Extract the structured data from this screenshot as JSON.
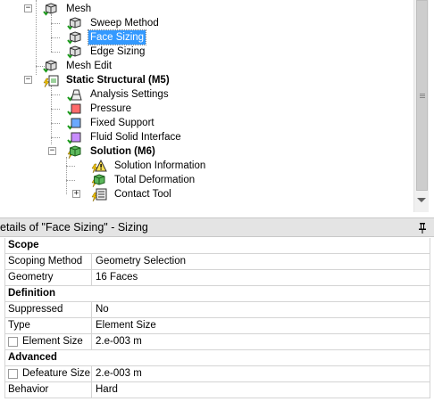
{
  "tree": {
    "nodes": [
      {
        "label": "Mesh",
        "icon": "mesh-icon",
        "bold": false,
        "selected": false
      },
      {
        "label": "Sweep Method",
        "icon": "sweep-method-icon",
        "bold": false,
        "selected": false
      },
      {
        "label": "Face Sizing",
        "icon": "face-sizing-icon",
        "bold": false,
        "selected": true
      },
      {
        "label": "Edge Sizing",
        "icon": "edge-sizing-icon",
        "bold": false,
        "selected": false
      },
      {
        "label": "Mesh Edit",
        "icon": "mesh-edit-icon",
        "bold": false,
        "selected": false
      },
      {
        "label": "Static Structural (M5)",
        "icon": "static-structural-icon",
        "bold": true,
        "selected": false
      },
      {
        "label": "Analysis Settings",
        "icon": "analysis-settings-icon",
        "bold": false,
        "selected": false
      },
      {
        "label": "Pressure",
        "icon": "pressure-icon",
        "bold": false,
        "selected": false
      },
      {
        "label": "Fixed Support",
        "icon": "fixed-support-icon",
        "bold": false,
        "selected": false
      },
      {
        "label": "Fluid Solid Interface",
        "icon": "fluid-solid-interface-icon",
        "bold": false,
        "selected": false
      },
      {
        "label": "Solution (M6)",
        "icon": "solution-icon",
        "bold": true,
        "selected": false
      },
      {
        "label": "Solution Information",
        "icon": "solution-information-icon",
        "bold": false,
        "selected": false
      },
      {
        "label": "Total Deformation",
        "icon": "total-deformation-icon",
        "bold": false,
        "selected": false
      },
      {
        "label": "Contact Tool",
        "icon": "contact-tool-icon",
        "bold": false,
        "selected": false
      }
    ],
    "expanders": {
      "collapse": "−",
      "expand": "+"
    }
  },
  "details": {
    "title": "etails of \"Face Sizing\" - Sizing",
    "pin_icon": "pin-icon",
    "rows": [
      {
        "type": "section",
        "label": "Scope"
      },
      {
        "type": "prop",
        "key": "Scoping Method",
        "value": "Geometry Selection"
      },
      {
        "type": "prop",
        "key": "Geometry",
        "value": "16 Faces"
      },
      {
        "type": "section",
        "label": "Definition"
      },
      {
        "type": "prop",
        "key": "Suppressed",
        "value": "No"
      },
      {
        "type": "prop",
        "key": "Type",
        "value": "Element Size"
      },
      {
        "type": "check",
        "key": "Element Size",
        "value": "2.e-003 m"
      },
      {
        "type": "section",
        "label": "Advanced"
      },
      {
        "type": "check",
        "key": "Defeature Size",
        "value": "2.e-003 m"
      },
      {
        "type": "prop",
        "key": "Behavior",
        "value": "Hard"
      }
    ]
  },
  "colors": {
    "selection": "#3399ff",
    "check": "#1a9a1a",
    "lightning": "#f2c200",
    "header_bg": "#e4e4e4"
  }
}
